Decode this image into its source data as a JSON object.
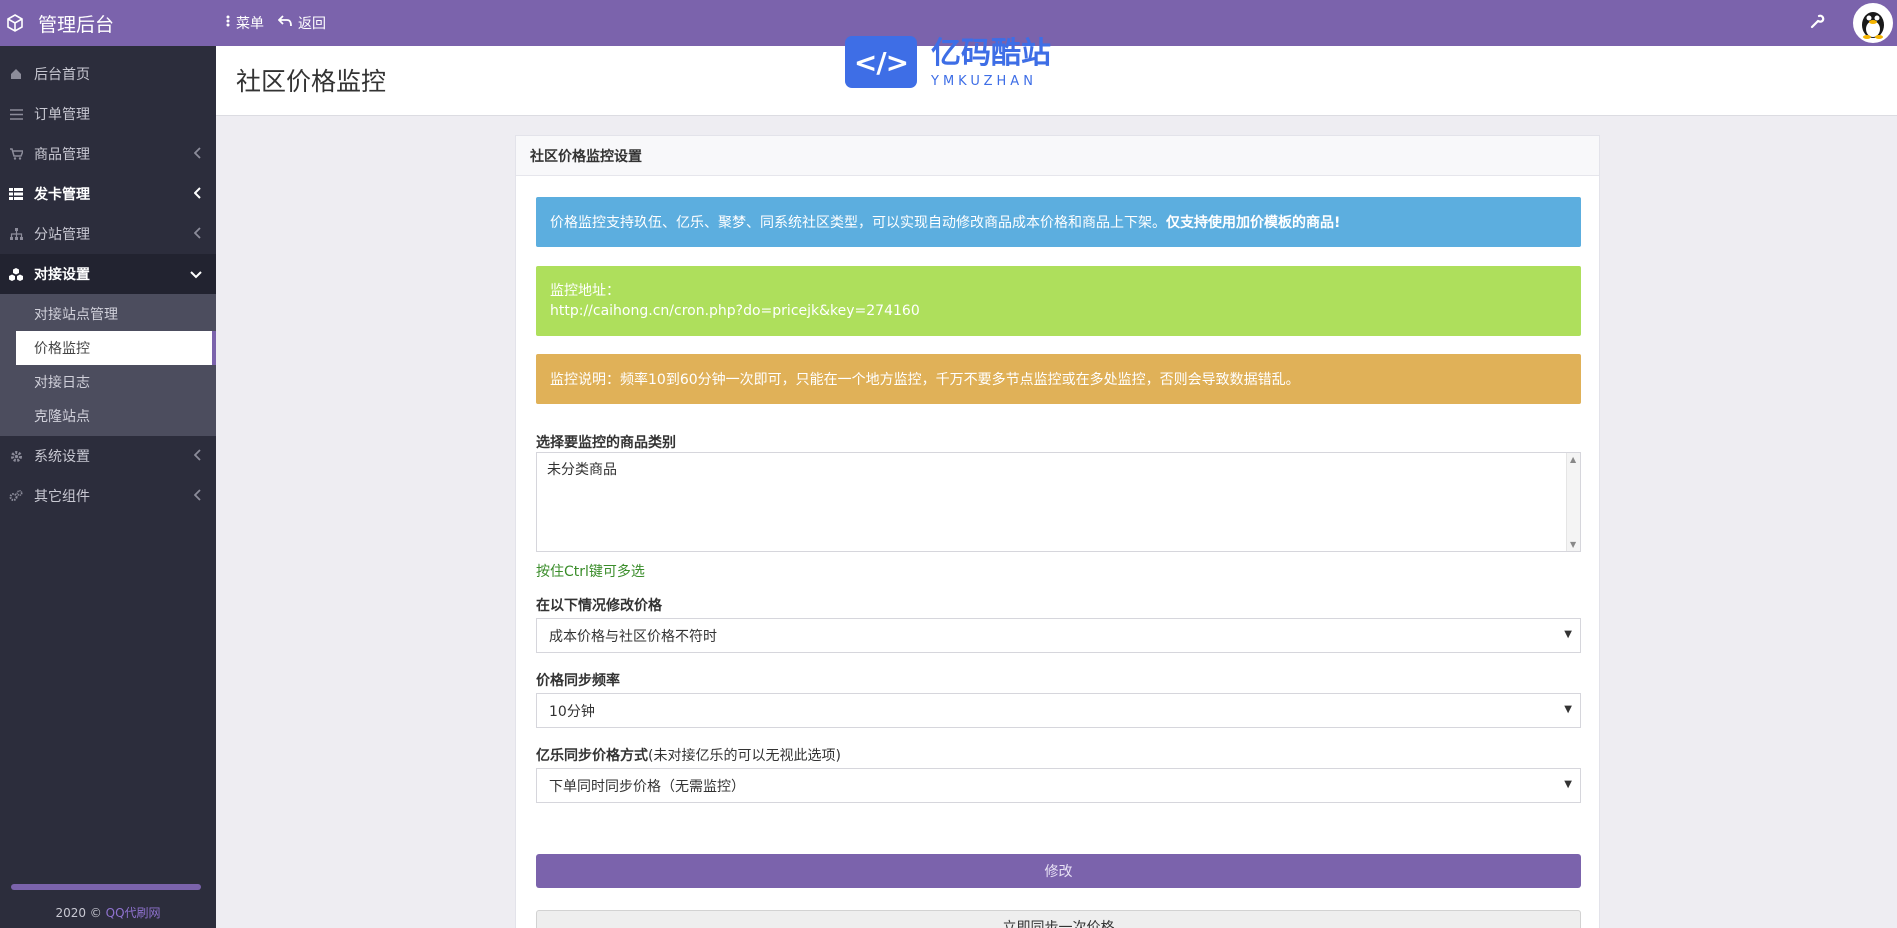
{
  "app": {
    "title": "管理后台"
  },
  "topnav": {
    "menu_label": "菜单",
    "back_label": "返回"
  },
  "sidebar": {
    "items": [
      {
        "label": "后台首页"
      },
      {
        "label": "订单管理"
      },
      {
        "label": "商品管理"
      },
      {
        "label": "发卡管理"
      },
      {
        "label": "分站管理"
      },
      {
        "label": "对接设置"
      },
      {
        "label": "系统设置"
      },
      {
        "label": "其它组件"
      }
    ],
    "subitems": [
      {
        "label": "对接站点管理"
      },
      {
        "label": "价格监控"
      },
      {
        "label": "对接日志"
      },
      {
        "label": "克隆站点"
      }
    ],
    "footer_year": "2020 ©",
    "footer_link": "QQ代刷网"
  },
  "page": {
    "title": "社区价格监控"
  },
  "watermark": {
    "cn": "亿码酷站",
    "en": "YMKUZHAN"
  },
  "panel": {
    "title": "社区价格监控设置",
    "info_text": "价格监控支持玖伍、亿乐、聚梦、同系统社区类型，可以实现自动修改商品成本价格和商品上下架。",
    "info_bold": "仅支持使用加价模板的商品!",
    "monitor_label": "监控地址：",
    "monitor_url": "http://caihong.cn/cron.php?do=pricejk&key=274160",
    "warning_text": "监控说明：频率10到60分钟一次即可，只能在一个地方监控，千万不要多节点监控或在多处监控，否则会导致数据错乱。",
    "category_label": "选择要监控的商品类别",
    "category_option": "未分类商品",
    "category_help": "按住Ctrl键可多选",
    "modify_label": "在以下情况修改价格",
    "modify_value": "成本价格与社区价格不符时",
    "freq_label": "价格同步频率",
    "freq_value": "10分钟",
    "yile_label": "亿乐同步价格方式",
    "yile_note": "(未对接亿乐的可以无视此选项)",
    "yile_value": "下单同时同步价格（无需监控）",
    "submit_label": "修改",
    "sync_label": "立即同步一次价格"
  },
  "colors": {
    "brand": "#7b63ac",
    "sidebar": "#2c2d3c",
    "info": "#5caedf",
    "success": "#aedf5c",
    "warning": "#e0b158"
  }
}
